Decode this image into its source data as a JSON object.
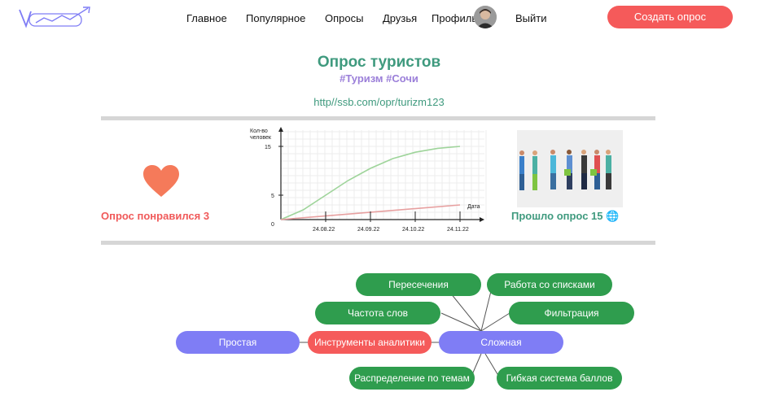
{
  "nav": {
    "items": [
      "Главное",
      "Популярное",
      "Опросы",
      "Друзья",
      "Профиль",
      "Выйти"
    ],
    "create_button": "Создать опрос"
  },
  "poll": {
    "title": "Опрос туристов",
    "tags": "#Туризм #Сочи",
    "url": "http//ssb.com/opr/turizm123",
    "liked_text": "Опрос понравился 3",
    "passed_text": "Прошло опрос 15"
  },
  "chart_data": {
    "type": "line",
    "ylabel": "Кол-во человек",
    "xlabel": "Дата",
    "x_ticks": [
      "24.08.22",
      "24.09.22",
      "24.10.22",
      "24.11.22"
    ],
    "y_ticks": [
      "0",
      "5",
      "15"
    ],
    "ylim": [
      0,
      17
    ],
    "series": [
      {
        "color": "#9ed49a",
        "x": [
          0,
          0.5,
          1,
          1.5,
          2,
          2.5,
          3,
          3.5,
          4
        ],
        "values": [
          0,
          2,
          5,
          8,
          10.5,
          12.5,
          13.8,
          14.6,
          15
        ]
      },
      {
        "color": "#e7a0a0",
        "x": [
          0,
          4
        ],
        "values": [
          0,
          3
        ]
      }
    ],
    "grid": true
  },
  "mindmap": {
    "left": "Простая",
    "center": "Инструменты аналитики",
    "right": "Сложная",
    "branches": [
      "Пересечения",
      "Работа со списками",
      "Частота слов",
      "Фильтрация",
      "Распределение по темам",
      "Гибкая система баллов"
    ]
  },
  "colors": {
    "accent": "#f55a5a",
    "green": "#2f9d4e",
    "teal": "#3f9a7e",
    "purple": "#7f7df5"
  }
}
